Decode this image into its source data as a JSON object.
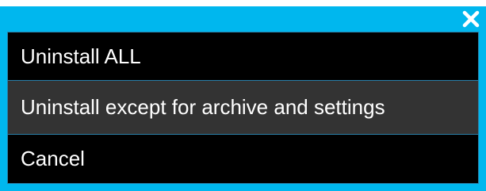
{
  "dialog": {
    "background_color": "#00b7ee",
    "close_icon": "close-icon",
    "items": [
      {
        "label": "Uninstall ALL",
        "background": "#000000"
      },
      {
        "label": "Uninstall except for archive and settings",
        "background": "#333333",
        "highlighted": true
      },
      {
        "label": "Cancel",
        "background": "#000000"
      }
    ]
  }
}
